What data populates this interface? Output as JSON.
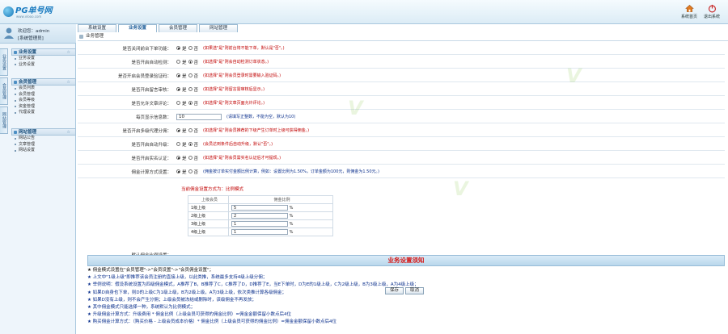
{
  "brand": {
    "name": "PG单号网",
    "slogan": "www.vlooo.com"
  },
  "top_actions": [
    {
      "label": "系统首页",
      "icon": "home-icon"
    },
    {
      "label": "退出系统",
      "icon": "logout-icon"
    }
  ],
  "tabs": [
    "系统设置",
    "业务设置",
    "会员管理",
    "网站管理"
  ],
  "user": {
    "name": "欢迎您：admin",
    "role": "[系统管理员]"
  },
  "vtabs": [
    "业务设置",
    "会员管理",
    "网站管理"
  ],
  "menu": [
    {
      "title": "业务设置",
      "items": [
        "业务设置",
        "业务设置"
      ]
    },
    {
      "title": "会员管理",
      "items": [
        "会员列表",
        "会员管理",
        "会员等级",
        "资金管理",
        "代理设置"
      ]
    },
    {
      "title": "网站管理",
      "items": [
        "网站公告",
        "文章管理",
        "网站设置"
      ]
    }
  ],
  "breadcrumb": "业务管理",
  "settings": [
    {
      "label": "是否关闭前台下单功能：",
      "on_label": "是",
      "off_label": "否",
      "selected": "on",
      "note": "(如果选\"是\"则前台将不能下单，默认是\"否\"。)",
      "note_color": "red"
    },
    {
      "label": "是否开启自动检测：",
      "on_label": "是",
      "off_label": "否",
      "selected": "off",
      "note": "(如选择\"是\"则会自动检测订单状态。)",
      "note_color": "red"
    },
    {
      "label": "是否开启会员登录验证码：",
      "on_label": "是",
      "off_label": "否",
      "selected": "on",
      "note": "(如选择\"是\"则会员登录时需要输入验证码。)",
      "note_color": "red"
    },
    {
      "label": "是否开启留言审核：",
      "on_label": "是",
      "off_label": "否",
      "selected": "on",
      "note": "(如选择\"是\"则留言需审核后显示。)",
      "note_color": "red"
    },
    {
      "label": "是否允许文章评论：",
      "on_label": "是",
      "off_label": "否",
      "selected": "off",
      "note": "(如选择\"是\"则文章页面允许评论。)",
      "note_color": "red"
    },
    {
      "label": "每页显示信息数：",
      "input_value": "10",
      "note": "(请填写正整数，不能为空，默认为10)",
      "note_color": "blue"
    },
    {
      "label": "是否开启多级代理分佣：",
      "on_label": "是",
      "off_label": "否",
      "selected": "on",
      "note": "(如选择\"是\"则会员推荐的下级产生订单时上级可获得佣金。)",
      "note_color": "red"
    },
    {
      "label": "是否开启自动升级：",
      "on_label": "是",
      "off_label": "否",
      "selected": "off",
      "note": "(会员达到条件后自动升级，默认\"否\"。)",
      "note_color": "red"
    },
    {
      "label": "是否开启实名认证：",
      "on_label": "是",
      "off_label": "否",
      "selected": "on",
      "note": "(如选择\"是\"则会员需实名认证后才可提现。)",
      "note_color": "red"
    },
    {
      "label": "佣金计算方式设置：",
      "on_label": "是",
      "off_label": "否",
      "selected": "on",
      "note": "(佣金按订单实付金额比例计算，例如：设置比例为1.50%，订单金额为100元，则佣金为1.50元。)",
      "note_color": "blue"
    }
  ],
  "ladder": {
    "title": "当前佣金设置方式为：比例模式",
    "label": "默认佣金比例设置：",
    "headers": [
      "上级会员",
      "佣金比例"
    ],
    "rows": [
      {
        "level": "1级上级",
        "value": "5",
        "unit": "%"
      },
      {
        "level": "2级上级",
        "value": "2",
        "unit": "%"
      },
      {
        "level": "3级上级",
        "value": "1",
        "unit": "%"
      },
      {
        "level": "4级上级",
        "value": "1",
        "unit": "%"
      }
    ]
  },
  "buttons": {
    "save": "保存",
    "cancel": "取消"
  },
  "banner": "业务设置须知",
  "notes": [
    "★ 佣金模式设置在\"会员管理\"->\"会员设置\"->\"会员佣金设置\"；",
    "★ 上文中\"1级上级\"即推荐该会员注册的直接上级，以此类推，系统最多支持4级上级分佣；",
    "★ 举例说明：假设系统设置为四级佣金模式，A推荐了B，B推荐了C，C推荐了D，D推荐了E，当E下单时，D为E的1级上级，C为2级上级，B为3级上级，A为4级上级；",
    "★ 如果D自身也下单，则D的上级C为1级上级，B为2级上级，A为3级上级，依次类推计算各级佣金；",
    "★ 如果D没有上级，则不会产生分佣；上级会员被冻结或删除时，该级佣金不再发放；",
    "★ 其中佣金模式只能选择一种，系统默认为比例模式；",
    "★ 升级佣金计算方式：升级费用 * 佣金比例（上级会员可获得的佣金比例）=佣金金额保留小数点后4位",
    "★ 购买佣金计算方式：（购买价格 - 上级会员成本价格）* 佣金比例（上级会员可获得的佣金比例）=佣金金额保留小数点后4位"
  ],
  "colors": {
    "accent": "#1a7bc0",
    "warning": "#c00000",
    "info": "#0a2f8c",
    "banner_text": "#d41a1a"
  }
}
